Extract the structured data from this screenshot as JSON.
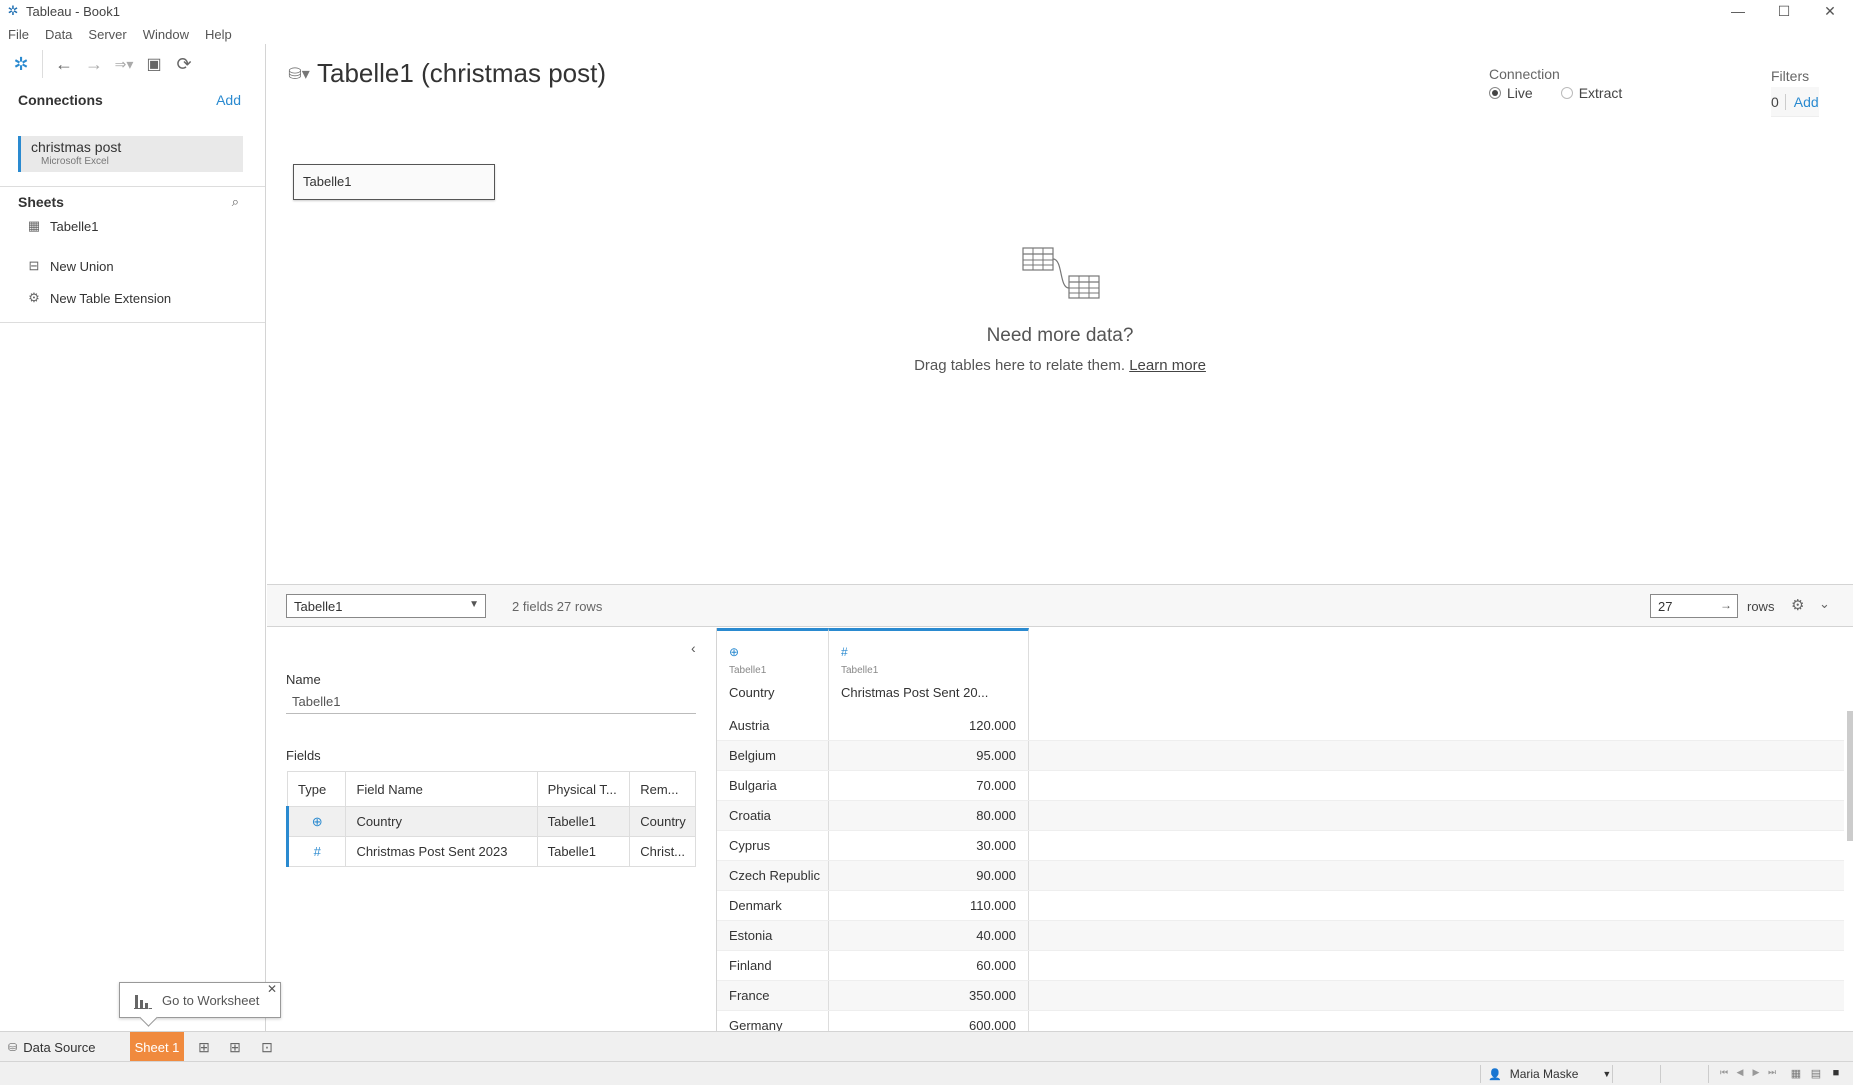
{
  "window": {
    "title": "Tableau - Book1"
  },
  "menu": [
    "File",
    "Data",
    "Server",
    "Window",
    "Help"
  ],
  "sidebar": {
    "connections_heading": "Connections",
    "add_label": "Add",
    "connection": {
      "name": "christmas post",
      "type": "Microsoft Excel"
    },
    "sheets_heading": "Sheets",
    "sheets": [
      {
        "label": "Tabelle1",
        "icon": "table-icon"
      },
      {
        "label": "New Union",
        "icon": "union-icon"
      },
      {
        "label": "New Table Extension",
        "icon": "extension-icon"
      }
    ]
  },
  "canvas": {
    "title": "Tabelle1 (christmas post)",
    "connection_heading": "Connection",
    "connection_options": [
      {
        "label": "Live",
        "selected": true
      },
      {
        "label": "Extract",
        "selected": false
      }
    ],
    "filters_heading": "Filters",
    "filters_count": "0",
    "filters_add": "Add",
    "table_box": "Tabelle1",
    "need_more_title": "Need more data?",
    "need_more_sub": "Drag tables here to relate them.",
    "learn_more": "Learn more"
  },
  "midbar": {
    "table_select": "Tabelle1",
    "fields_count": "2 fields 27 rows",
    "rows_value": "27",
    "rows_label": "rows"
  },
  "meta": {
    "name_label": "Name",
    "name_value": "Tabelle1",
    "fields_label": "Fields",
    "columns": [
      "Type",
      "Field Name",
      "Physical T...",
      "Rem..."
    ],
    "rows": [
      {
        "type": "⊕",
        "field": "Country",
        "physical": "Tabelle1",
        "remote": "Country"
      },
      {
        "type": "#",
        "field": "Christmas Post Sent 2023",
        "physical": "Tabelle1",
        "remote": "Christ..."
      }
    ]
  },
  "grid": {
    "columns": [
      {
        "type_icon": "⊕",
        "source": "Tabelle1",
        "name": "Country"
      },
      {
        "type_icon": "#",
        "source": "Tabelle1",
        "name": "Christmas Post Sent 20..."
      }
    ],
    "rows": [
      [
        "Austria",
        "120.000"
      ],
      [
        "Belgium",
        "95.000"
      ],
      [
        "Bulgaria",
        "70.000"
      ],
      [
        "Croatia",
        "80.000"
      ],
      [
        "Cyprus",
        "30.000"
      ],
      [
        "Czech Republic",
        "90.000"
      ],
      [
        "Denmark",
        "110.000"
      ],
      [
        "Estonia",
        "40.000"
      ],
      [
        "Finland",
        "60.000"
      ],
      [
        "France",
        "350.000"
      ],
      [
        "Germany",
        "600.000"
      ]
    ]
  },
  "tabs": {
    "data_source": "Data Source",
    "sheet": "Sheet 1",
    "tooltip": "Go to Worksheet"
  },
  "status": {
    "user": "Maria Maske"
  }
}
